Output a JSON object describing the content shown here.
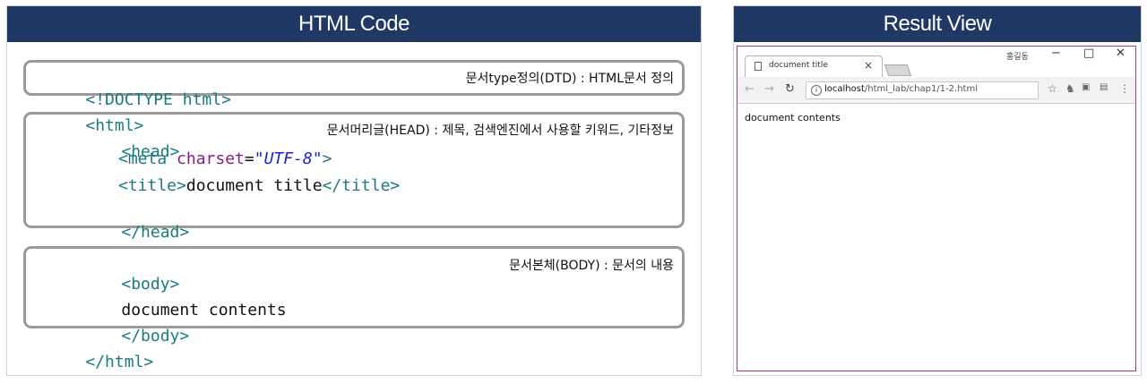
{
  "left": {
    "header": "HTML Code",
    "code": {
      "doctype": "<!DOCTYPE html>",
      "html_open": "<html>",
      "head_open": "<head>",
      "meta_open": "<meta ",
      "meta_attr": "charset",
      "meta_eq": "=",
      "meta_value": "\"UTF-8\"",
      "meta_close": ">",
      "title_open": "<title>",
      "title_text": "document title",
      "title_close": "</title>",
      "head_close": "</head>",
      "body_open": "<body>",
      "body_text": "document contents",
      "body_close": "</body>",
      "html_close": "</html>"
    },
    "annotations": {
      "dtd": "문서type정의(DTD) : HTML문서 정의",
      "head": "문서머리글(HEAD) : 제목, 검색엔진에서 사용할 키워드, 기타정보",
      "body": "문서본체(BODY) : 문서의 내용"
    }
  },
  "right": {
    "header": "Result View",
    "browser": {
      "tab_title": "document title",
      "tab_close": "×",
      "user_label": "홍길동",
      "win_minimize": "−",
      "win_maximize": "□",
      "win_close": "✕",
      "url_host": "localhost",
      "url_path": "/html_lab/chap1/1-2.html",
      "page_text": "document contents"
    }
  },
  "colors": {
    "header_bg": "#1f3864",
    "tag": "#1a7a80",
    "attr": "#8b1a8b",
    "string": "#1f1fd6",
    "box_border": "#9a9a9a"
  }
}
